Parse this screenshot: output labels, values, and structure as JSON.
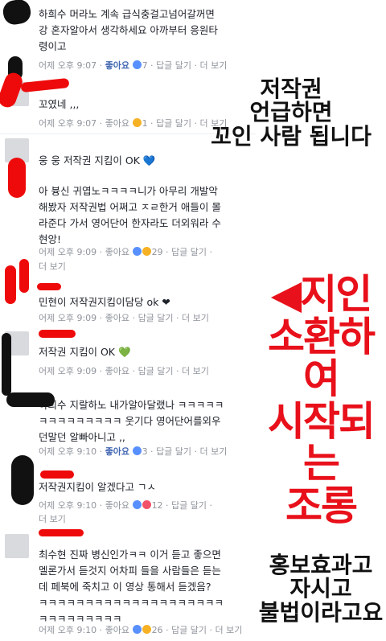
{
  "comments": [
    {
      "name": "",
      "text": "하희수 머라노 계속 급식충걸고넘어갈꺼면\n강 혼자알아서 생각하세요 아까부터 응원타\n령이고",
      "time": "어제 오후 9:07",
      "like": "좋아요",
      "reactions": "7",
      "reply": "답글 달기",
      "more": "더 보기",
      "reaction_icon": "like"
    },
    {
      "name": "",
      "text": "꼬였네 ,,,",
      "time": "어제 오후 9:07",
      "like": "좋아요",
      "reactions": "1",
      "reply": "답글 달기",
      "more": "더 보기",
      "reaction_icon": "haha"
    },
    {
      "name": "",
      "text": "웅 웅 저작권 지킴이 OK 💙",
      "time": "",
      "like": "",
      "reactions": "",
      "reply": "",
      "more": "",
      "reaction_icon": ""
    },
    {
      "name": "",
      "text": "아 븅신 귀엽노ㅋㅋㅋㅋ니가 아무리 개발악\n해봤자 저작권법 어쩌고 ㅈㄹ한거 애들이 몰\n라준다 가서 영어단어 한자라도 더외워라 수\n현앙!",
      "time": "어제 오후 9:09",
      "like": "좋아요",
      "reactions": "29",
      "reply": "답글 달기",
      "more": "더 보기",
      "reaction_icon": "like"
    },
    {
      "name": "",
      "text": "민현이 저작권지킴이담당 ok ❤",
      "time": "어제 오후 9:09",
      "like": "좋아요",
      "reactions": "",
      "reply": "답글 달기",
      "more": "더 보기",
      "reaction_icon": ""
    },
    {
      "name": "",
      "text": "저작권 지킴이 OK 💚",
      "time": "어제 오후 9:09",
      "like": "좋아요",
      "reactions": "",
      "reply": "답글 달기",
      "more": "더 보기",
      "reaction_icon": ""
    },
    {
      "name": "",
      "text": "하희수 지랄하노 내가알아달랬나 ㅋㅋㅋㅋㅋ\nㅋㅋㅋㅋㅋㅋㅋㅋㅋ 웃기다 영어단어를외우\n던말던 알빠아니고 ,,",
      "time": "어제 오후 9:10",
      "like": "좋아요",
      "reactions": "3",
      "reply": "답글 달기",
      "more": "더 보기",
      "reaction_icon": "like"
    },
    {
      "name": "",
      "text": "저작권지킴이 알겠다고 ㄱㅅ",
      "time": "어제 오후 9:10",
      "like": "좋아요",
      "reactions": "12",
      "reply": "답글 달기",
      "more": "더 보기",
      "reaction_icon": "love"
    },
    {
      "name": "",
      "text": "최수현 진짜 병신인가ㅋㅋ 이거 듣고 좋으면\n멜론가서 듣것지 어차피 들을 사람들은 듣는\n데 페북에 죽치고 이 영상 통해서 듣겠음?\nㅋㅋㅋㅋㅋㅋㅋㅋㅋㅋㅋㅋㅋㅋㅋㅋㅋㅋㅋㅋ\nㅋㅋㅋㅋㅋㅋㅋㅋㅋ",
      "time": "어제 오후 9:10",
      "like": "좋아요",
      "reactions": "26",
      "reply": "답글 달기",
      "more": "더 보기",
      "reaction_icon": "like"
    }
  ],
  "captions": {
    "top": "저작권\n언급하면\n꼬인 사람 됩니다",
    "middle": "◀지인\n소환하여\n시작되는\n조롱",
    "bottom": "홍보효과고\n자시고\n불법이라고요"
  },
  "colors": {
    "like_blue": "#4267b2",
    "meta_gray": "#90949c",
    "caption_red": "#e8101a",
    "scribble_red": "#ee0a0a",
    "scribble_black": "#111111"
  }
}
